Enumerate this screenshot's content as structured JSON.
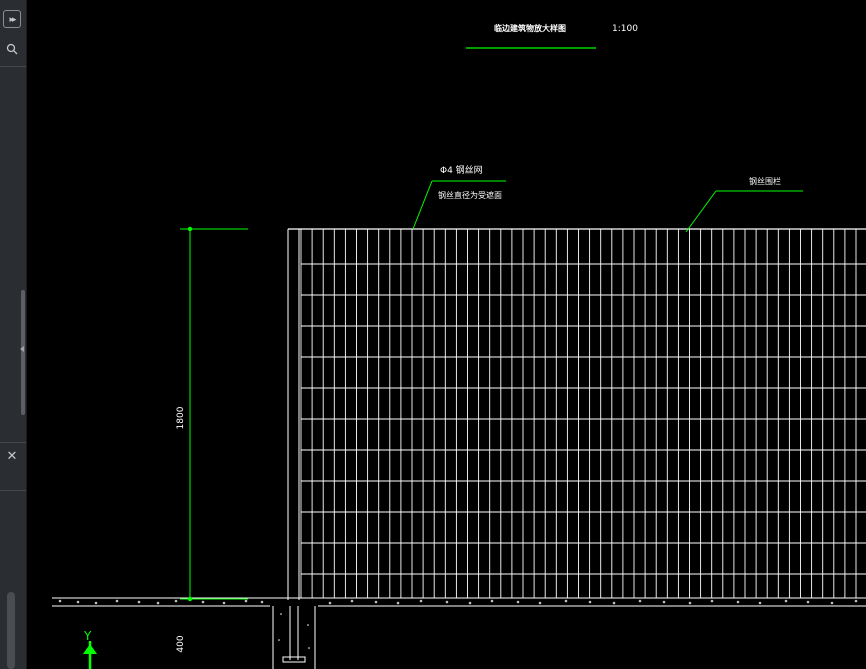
{
  "sidebar": {
    "expand_icon": "double-chevron-right-icon",
    "search_icon": "search-icon",
    "close_label": "✕"
  },
  "drawing": {
    "title": "临边建筑物放大样图",
    "scale": "1:100",
    "annotation_mesh_line1": "Φ4 钢丝网",
    "annotation_mesh_line2": "钢丝直径为受遮面",
    "annotation_fence": "钢丝围栏",
    "dimension_height": "1800",
    "dimension_footing": "400",
    "ucs_y_label": "Y",
    "colors": {
      "background": "#000000",
      "geometry": "#ffffff",
      "leader": "#00ff00",
      "text": "#ffffff"
    }
  }
}
